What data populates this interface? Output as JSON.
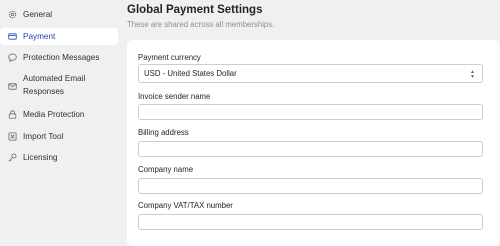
{
  "sidebar": {
    "items": [
      {
        "label": "General",
        "icon": "gear-icon"
      },
      {
        "label": "Payment",
        "icon": "credit-card-icon",
        "active": true
      },
      {
        "label": "Protection Messages",
        "icon": "chat-bubble-icon"
      },
      {
        "label": "Automated Email Responses",
        "icon": "envelope-icon"
      },
      {
        "label": "Media Protection",
        "icon": "lock-icon"
      },
      {
        "label": "Import Tool",
        "icon": "import-icon"
      },
      {
        "label": "Licensing",
        "icon": "key-icon"
      }
    ]
  },
  "main": {
    "title": "Global Payment Settings",
    "subtitle": "These are shared across all memberships.",
    "fields": {
      "currency": {
        "label": "Payment currency",
        "value": "USD - United States Dollar"
      },
      "invoice_sender": {
        "label": "Invoice sender name",
        "value": ""
      },
      "billing_address": {
        "label": "Billing address",
        "value": ""
      },
      "company_name": {
        "label": "Company name",
        "value": ""
      },
      "vat_number": {
        "label": "Company VAT/TAX number",
        "value": ""
      }
    }
  },
  "colors": {
    "accent": "#2145c4",
    "page_background": "#f0f0f1",
    "card_background": "#ffffff"
  }
}
